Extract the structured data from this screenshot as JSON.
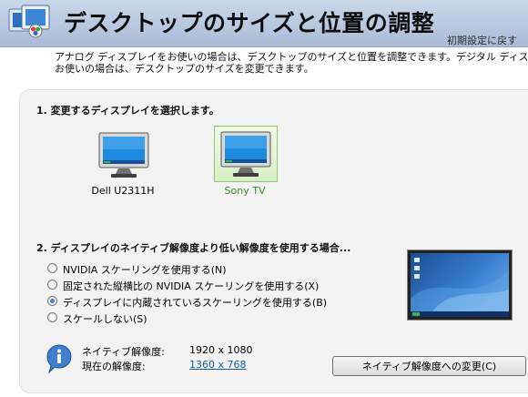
{
  "header": {
    "title": "デスクトップのサイズと位置の調整",
    "restore_link": "初期設定に戻す"
  },
  "description": {
    "line1": "アナログ ディスプレイをお使いの場合は、デスクトップのサイズと位置を調整できます。デジタル ディスプレイをお",
    "line2": "お使いの場合は、デスクトップのサイズを変更できます。"
  },
  "section1": {
    "heading": "1. 変更するディスプレイを選択します。",
    "displays": [
      {
        "label": "Dell U2311H",
        "selected": false
      },
      {
        "label": "Sony TV",
        "selected": true
      }
    ]
  },
  "section2": {
    "heading": "2. ディスプレイのネイティブ解像度より低い解像度を使用する場合...",
    "options": [
      {
        "label": "NVIDIA スケーリングを使用する(N)",
        "checked": false
      },
      {
        "label": "固定された縦横比の NVIDIA スケーリングを使用する(X)",
        "checked": false
      },
      {
        "label": "ディスプレイに内蔵されているスケーリングを使用する(B)",
        "checked": true
      },
      {
        "label": "スケールしない(S)",
        "checked": false
      }
    ]
  },
  "resolution": {
    "native_label": "ネイティブ解像度:",
    "native_value": "1920 x 1080",
    "current_label": "現在の解像度:",
    "current_value": "1360 x 768"
  },
  "buttons": {
    "change_native": "ネイティブ解像度への変更(C)"
  },
  "colors": {
    "accent_link": "#0b5ea8",
    "selected_label": "#3b8e22",
    "selected_border": "#8fc870"
  }
}
